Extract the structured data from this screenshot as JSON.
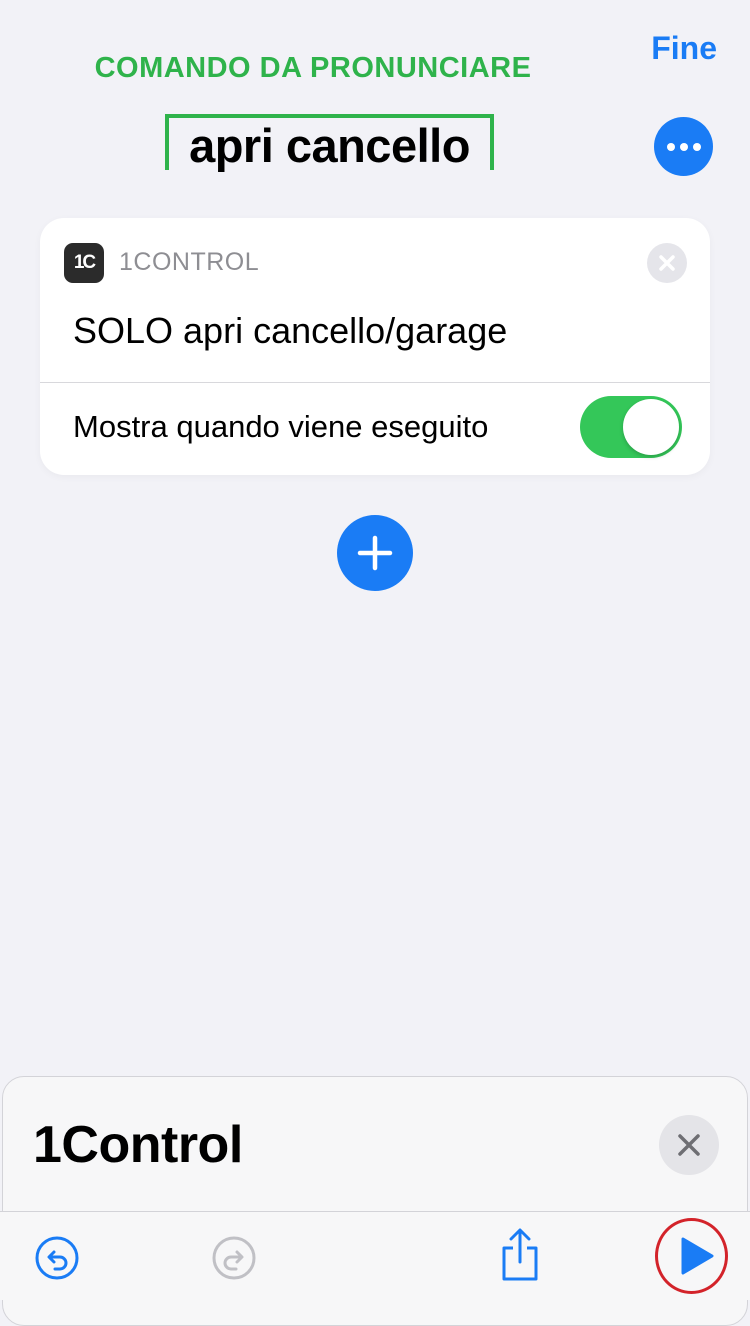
{
  "annotation": {
    "label": "COMANDO DA PRONUNCIARE"
  },
  "header": {
    "done_label": "Fine",
    "shortcut_name": "apri cancello"
  },
  "action_card": {
    "app_icon_text": "1C",
    "app_name": "1CONTROL",
    "action_title": "SOLO apri cancello/garage",
    "toggle_label": "Mostra quando viene eseguito",
    "toggle_on": true
  },
  "sheet": {
    "title": "1Control"
  },
  "toolbar": {
    "items": [
      "undo-icon",
      "redo-icon",
      "share-icon",
      "play-icon"
    ]
  },
  "colors": {
    "accent": "#1a7cf5",
    "annotation_green": "#2fb34b",
    "toggle_on": "#34c759",
    "highlight_red": "#d3232a",
    "background": "#f2f2f7"
  }
}
